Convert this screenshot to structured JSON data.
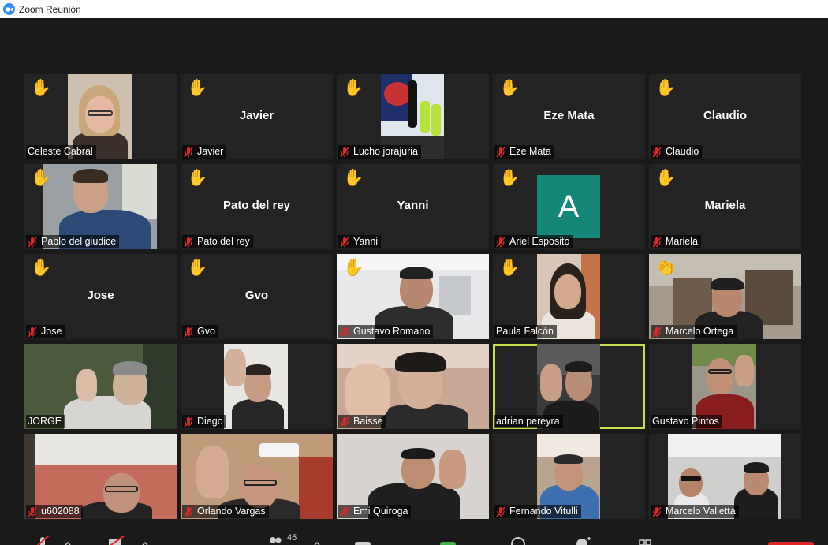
{
  "window": {
    "title": "Zoom Reunión"
  },
  "participants": [
    {
      "name": "Celeste Cabral",
      "hand": true,
      "muted": false
    },
    {
      "name": "Javier",
      "hand": true,
      "muted": true,
      "display": "Javier"
    },
    {
      "name": "Lucho jorajuria",
      "hand": true,
      "muted": true
    },
    {
      "name": "Eze Mata",
      "hand": true,
      "muted": true,
      "display": "Eze Mata"
    },
    {
      "name": "Claudio",
      "hand": true,
      "muted": true,
      "display": "Claudio"
    },
    {
      "name": "Pablo del giudice",
      "hand": true,
      "muted": true
    },
    {
      "name": "Pato del rey",
      "hand": true,
      "muted": true,
      "display": "Pato del rey"
    },
    {
      "name": "Yanni",
      "hand": true,
      "muted": true,
      "display": "Yanni"
    },
    {
      "name": "Ariel Esposito",
      "hand": true,
      "muted": true,
      "avatar": "A"
    },
    {
      "name": "Mariela",
      "hand": true,
      "muted": true,
      "display": "Mariela"
    },
    {
      "name": "Jose",
      "hand": true,
      "muted": true,
      "display": "Jose"
    },
    {
      "name": "Gvo",
      "hand": true,
      "muted": true,
      "display": "Gvo"
    },
    {
      "name": "Gustavo Romano",
      "hand": true,
      "muted": true
    },
    {
      "name": "Paula Falcón",
      "hand": true,
      "muted": false
    },
    {
      "name": "Marcelo Ortega",
      "hand": false,
      "clap": true,
      "muted": true
    },
    {
      "name": "JORGE",
      "hand": false,
      "muted": false
    },
    {
      "name": "Diego",
      "hand": false,
      "muted": true
    },
    {
      "name": "Baisse",
      "hand": false,
      "muted": true
    },
    {
      "name": "adrian pereyra",
      "hand": false,
      "muted": false,
      "active": true
    },
    {
      "name": "Gustavo Pintos",
      "hand": false,
      "muted": false
    },
    {
      "name": "u602088",
      "hand": false,
      "muted": true
    },
    {
      "name": "Orlando Vargas",
      "hand": false,
      "muted": true
    },
    {
      "name": "Emi Quiroga",
      "hand": false,
      "muted": true
    },
    {
      "name": "Fernando Vitulli",
      "hand": false,
      "muted": true
    },
    {
      "name": "Marcelo Valletta",
      "hand": false,
      "muted": true
    }
  ],
  "toolbar": {
    "participants_count": "45"
  },
  "icons": {
    "hand": "raised-hand-icon",
    "clap": "clap-icon",
    "mute": "mic-muted-icon"
  },
  "colors": {
    "active_border": "#c5e04b",
    "avatar_bg": "#14877a",
    "hand": "#f3c33c",
    "mute": "#e02828"
  }
}
